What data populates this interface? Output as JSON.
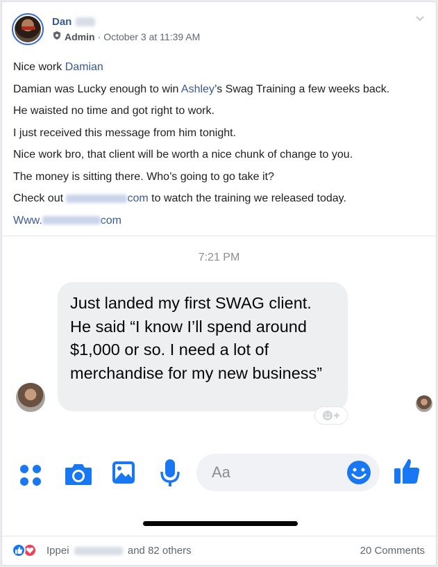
{
  "post": {
    "author_first": "Dan",
    "role_badge": "Admin",
    "separator": "·",
    "timestamp": "October 3 at 11:39 AM",
    "lines": {
      "l1_text": "Nice work ",
      "l1_mention": "Damian",
      "l2_a": "Damian was Lucky enough to win ",
      "l2_mention": "Ashley",
      "l2_b": "’s Swag Training a few weeks back.",
      "l3": "He waisted no time and got right to work.",
      "l4": "I just received this message from him tonight.",
      "l5": "Nice work bro, that client will be worth a nice chunk of change to you.",
      "l6": "The money is sitting there. Who’s going to go take it?",
      "l7_a": "Check out ",
      "l7_link_suffix": "com",
      "l7_b": " to watch the training we released today.",
      "l8_prefix": "Www.",
      "l8_suffix": "com"
    }
  },
  "screenshot": {
    "time": "7:21 PM",
    "message": "Just landed my first SWAG client. He said “I know I’ll spend around $1,000 or so. I need a lot of merchandise for my new business”",
    "composer_placeholder": "Aa"
  },
  "footer": {
    "reactor_first": "Ippei",
    "others": "and 82 others",
    "comments": "20 Comments"
  },
  "colors": {
    "messenger_blue": "#1877f2",
    "link_blue": "#385898",
    "love_red": "#f33e58"
  },
  "icons": [
    "chevron-down-icon",
    "admin-shield-icon",
    "apps-icon",
    "camera-icon",
    "gallery-icon",
    "microphone-icon",
    "emoji-icon",
    "thumbs-up-icon",
    "add-reaction-icon",
    "like-reaction-icon",
    "love-reaction-icon"
  ]
}
